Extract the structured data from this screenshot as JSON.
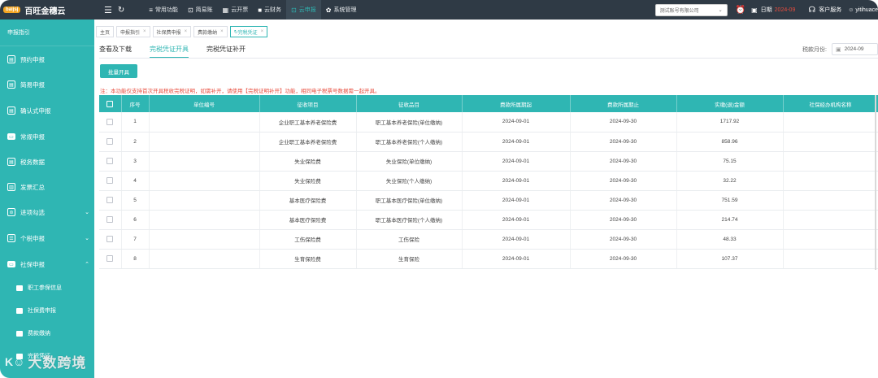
{
  "app": {
    "logo_badge": "baijsj",
    "name": "百旺金穗云"
  },
  "topnav": [
    {
      "icon": "≡",
      "label": "常用功能",
      "active": false
    },
    {
      "icon": "⊡",
      "label": "简易账",
      "active": false
    },
    {
      "icon": "▦",
      "label": "云开票",
      "active": false
    },
    {
      "icon": "■",
      "label": "云财务",
      "active": false
    },
    {
      "icon": "⊡",
      "label": "云申报",
      "active": true
    },
    {
      "icon": "✿",
      "label": "系统管理",
      "active": false
    }
  ],
  "header": {
    "company": "测试账号有限公司",
    "date_label": "日期",
    "date_value": "2024-09",
    "service": "客户服务",
    "user": "yitihuace"
  },
  "sidebar": {
    "head": "申报指引",
    "items": [
      {
        "label": "预约申报",
        "icon": "doc"
      },
      {
        "label": "简易申报",
        "icon": "doc"
      },
      {
        "label": "确认式申报",
        "icon": "doc"
      },
      {
        "label": "常规申报",
        "icon": "monitor"
      },
      {
        "label": "税务数据",
        "icon": "doc"
      },
      {
        "label": "发票汇总",
        "icon": "chart"
      },
      {
        "label": "进项勾选",
        "icon": "stack",
        "arrow": "⌄"
      },
      {
        "label": "个税申报",
        "icon": "list",
        "arrow": "⌄"
      },
      {
        "label": "社保申报",
        "icon": "monitor",
        "arrow": "⌃"
      }
    ],
    "subitems": [
      {
        "label": "职工参保信息"
      },
      {
        "label": "社保费申报"
      },
      {
        "label": "费款缴纳"
      },
      {
        "label": "完税凭证"
      }
    ]
  },
  "crumbs": [
    {
      "label": "主页",
      "closable": false,
      "active": false
    },
    {
      "label": "申报指引",
      "closable": true,
      "active": false
    },
    {
      "label": "社保费申报",
      "closable": true,
      "active": false
    },
    {
      "label": "费款缴纳",
      "closable": true,
      "active": false
    },
    {
      "label": "完税凭证",
      "closable": true,
      "active": true
    }
  ],
  "subtabs": [
    {
      "label": "查看及下载",
      "active": false
    },
    {
      "label": "完税凭证开具",
      "active": true
    },
    {
      "label": "完税凭证补开",
      "active": false
    }
  ],
  "period": {
    "label": "税款月份:",
    "value": "2024-09"
  },
  "batch_button": "批量开具",
  "notice": "注：本功能仅支持首次开具税收完税证明，如需补开，请使用【完税证明补开】功能，相同电子税票号数据需一起开具。",
  "table": {
    "columns": [
      "序号",
      "单位编号",
      "征收项目",
      "征收品目",
      "费款所属期起",
      "费款所属期止",
      "实缴(退)金额",
      "社保经办机构名称"
    ],
    "rows": [
      [
        "1",
        "",
        "企业职工基本养老保险费",
        "职工基本养老保险(单位缴纳)",
        "2024-09-01",
        "2024-09-30",
        "1717.92",
        ""
      ],
      [
        "2",
        "",
        "企业职工基本养老保险费",
        "职工基本养老保险(个人缴纳)",
        "2024-09-01",
        "2024-09-30",
        "858.96",
        ""
      ],
      [
        "3",
        "",
        "失业保险费",
        "失业保险(单位缴纳)",
        "2024-09-01",
        "2024-09-30",
        "75.15",
        ""
      ],
      [
        "4",
        "",
        "失业保险费",
        "失业保险(个人缴纳)",
        "2024-09-01",
        "2024-09-30",
        "32.22",
        ""
      ],
      [
        "5",
        "",
        "基本医疗保险费",
        "职工基本医疗保险(单位缴纳)",
        "2024-09-01",
        "2024-09-30",
        "751.59",
        ""
      ],
      [
        "6",
        "",
        "基本医疗保险费",
        "职工基本医疗保险(个人缴纳)",
        "2024-09-01",
        "2024-09-30",
        "214.74",
        ""
      ],
      [
        "7",
        "",
        "工伤保险费",
        "工伤保险",
        "2024-09-01",
        "2024-09-30",
        "48.33",
        ""
      ],
      [
        "8",
        "",
        "生育保险费",
        "生育保险",
        "2024-09-01",
        "2024-09-30",
        "107.37",
        ""
      ]
    ]
  },
  "watermark": {
    "logo": "K☺",
    "text": "大数跨境"
  },
  "colors": {
    "accent": "#2fb6b3",
    "topbar": "#2f3a45",
    "warning": "#e84c3d"
  }
}
